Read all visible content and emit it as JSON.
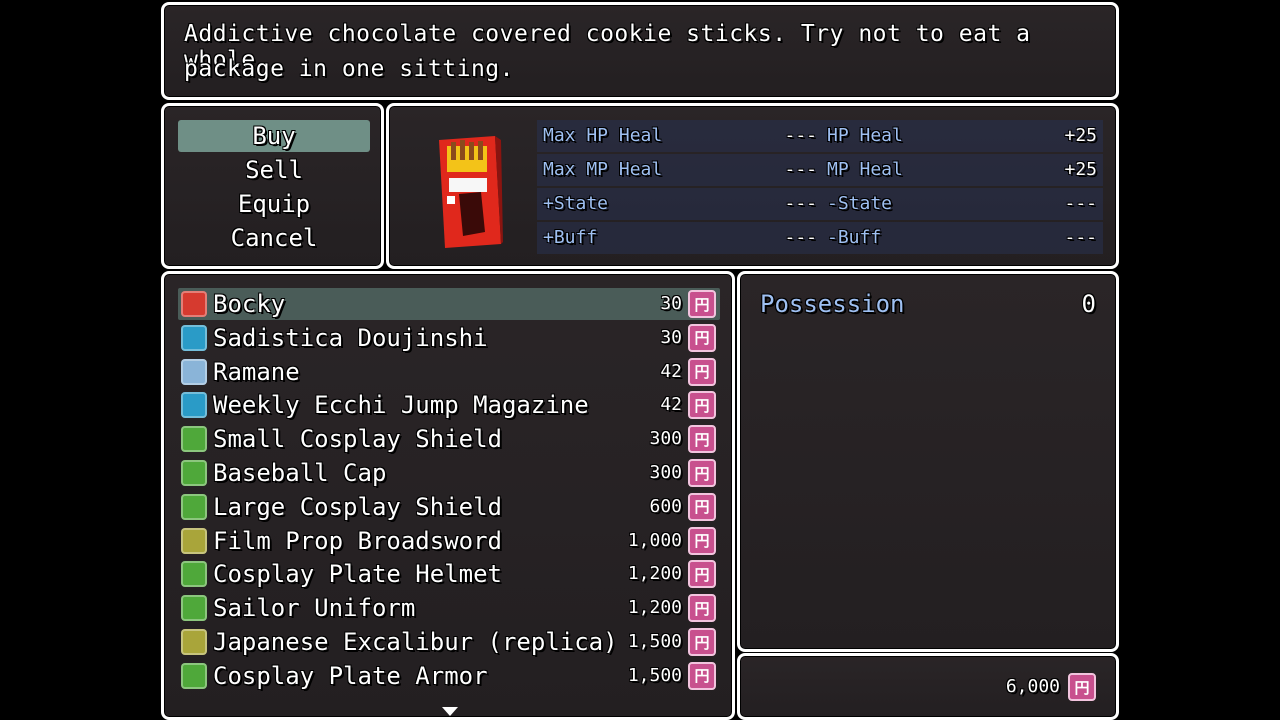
{
  "help": {
    "line1": "Addictive chocolate covered cookie sticks. Try not to eat a whole",
    "line2": "package in one sitting."
  },
  "commands": [
    {
      "label": "Buy",
      "selected": true
    },
    {
      "label": "Sell"
    },
    {
      "label": "Equip"
    },
    {
      "label": "Cancel"
    }
  ],
  "status": {
    "rows": [
      {
        "l1": "Max HP Heal",
        "v1": "---",
        "l2": "HP Heal",
        "v2": "+25"
      },
      {
        "l1": "Max MP Heal",
        "v1": "---",
        "l2": "MP Heal",
        "v2": "+25"
      },
      {
        "l1": "+State",
        "v1": "---",
        "l2": "-State",
        "v2": "---"
      },
      {
        "l1": "+Buff",
        "v1": "---",
        "l2": "-Buff",
        "v2": "---"
      }
    ]
  },
  "items": [
    {
      "name": "Bocky",
      "price": "30",
      "icon": "snack-box-icon",
      "color": "#d63a2f"
    },
    {
      "name": "Sadistica Doujinshi",
      "price": "30",
      "icon": "book-icon",
      "color": "#2a9bc7"
    },
    {
      "name": "Ramane",
      "price": "42",
      "icon": "bottle-icon",
      "color": "#8ab4d8"
    },
    {
      "name": "Weekly Ecchi Jump Magazine",
      "price": "42",
      "icon": "book-icon",
      "color": "#2a9bc7"
    },
    {
      "name": "Small Cosplay Shield",
      "price": "300",
      "icon": "shield-icon",
      "color": "#4fa83a"
    },
    {
      "name": "Baseball Cap",
      "price": "300",
      "icon": "hat-icon",
      "color": "#4fa83a"
    },
    {
      "name": "Large Cosplay Shield",
      "price": "600",
      "icon": "shield-icon",
      "color": "#4fa83a"
    },
    {
      "name": "Film Prop Broadsword",
      "price": "1,000",
      "icon": "sword-icon",
      "color": "#a9a53a"
    },
    {
      "name": "Cosplay Plate Helmet",
      "price": "1,200",
      "icon": "helmet-icon",
      "color": "#4fa83a"
    },
    {
      "name": "Sailor Uniform",
      "price": "1,200",
      "icon": "clothes-icon",
      "color": "#4fa83a"
    },
    {
      "name": "Japanese Excalibur (replica)",
      "price": "1,500",
      "icon": "sword-icon",
      "color": "#a9a53a"
    },
    {
      "name": "Cosplay Plate Armor",
      "price": "1,500",
      "icon": "armor-icon",
      "color": "#4fa83a"
    }
  ],
  "possession": {
    "label": "Possession",
    "value": "0"
  },
  "gold": {
    "value": "6,000"
  },
  "colors": {
    "accent_label": "#9fc0f2",
    "selected_command": "#6f8f86",
    "selected_row": "#4a5c58",
    "currency": "#c8508e"
  }
}
